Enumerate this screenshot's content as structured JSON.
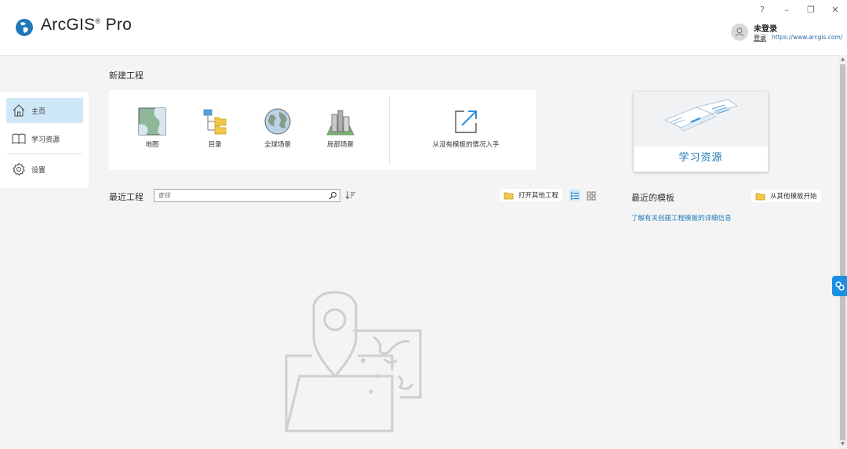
{
  "app": {
    "title_main": "ArcGIS",
    "title_mark": "®",
    "title_suffix": "Pro"
  },
  "window_controls": {
    "help": "?",
    "minimize": "–",
    "restore": "❐",
    "close": "✕"
  },
  "user": {
    "name": "未登录",
    "signin": "登录",
    "portal_url": "https://www.arcgis.com/"
  },
  "sidebar": {
    "items": [
      {
        "label": "主页",
        "icon": "home-icon"
      },
      {
        "label": "学习资源",
        "icon": "book-icon"
      },
      {
        "label": "设置",
        "icon": "gear-icon"
      }
    ]
  },
  "new_project": {
    "title": "新建工程",
    "tiles": [
      {
        "label": "地图",
        "icon": "map-icon"
      },
      {
        "label": "目录",
        "icon": "catalog-icon"
      },
      {
        "label": "全球场景",
        "icon": "globe-icon"
      },
      {
        "label": "局部场景",
        "icon": "local-scene-icon"
      }
    ],
    "start_without_template": "从没有模板的情况入手"
  },
  "learning": {
    "card_label": "学习资源"
  },
  "recent_projects": {
    "title": "最近工程",
    "search_placeholder": "查找",
    "open_other": "打开其他工程"
  },
  "recent_templates": {
    "title": "最近的模板",
    "start_other": "从其他模板开始",
    "learn_link": "了解有关创建工程模板的详细信息"
  },
  "colors": {
    "accent": "#1f79b9",
    "active_nav": "#cfe8f8",
    "side_tab": "#1a8fe3"
  }
}
